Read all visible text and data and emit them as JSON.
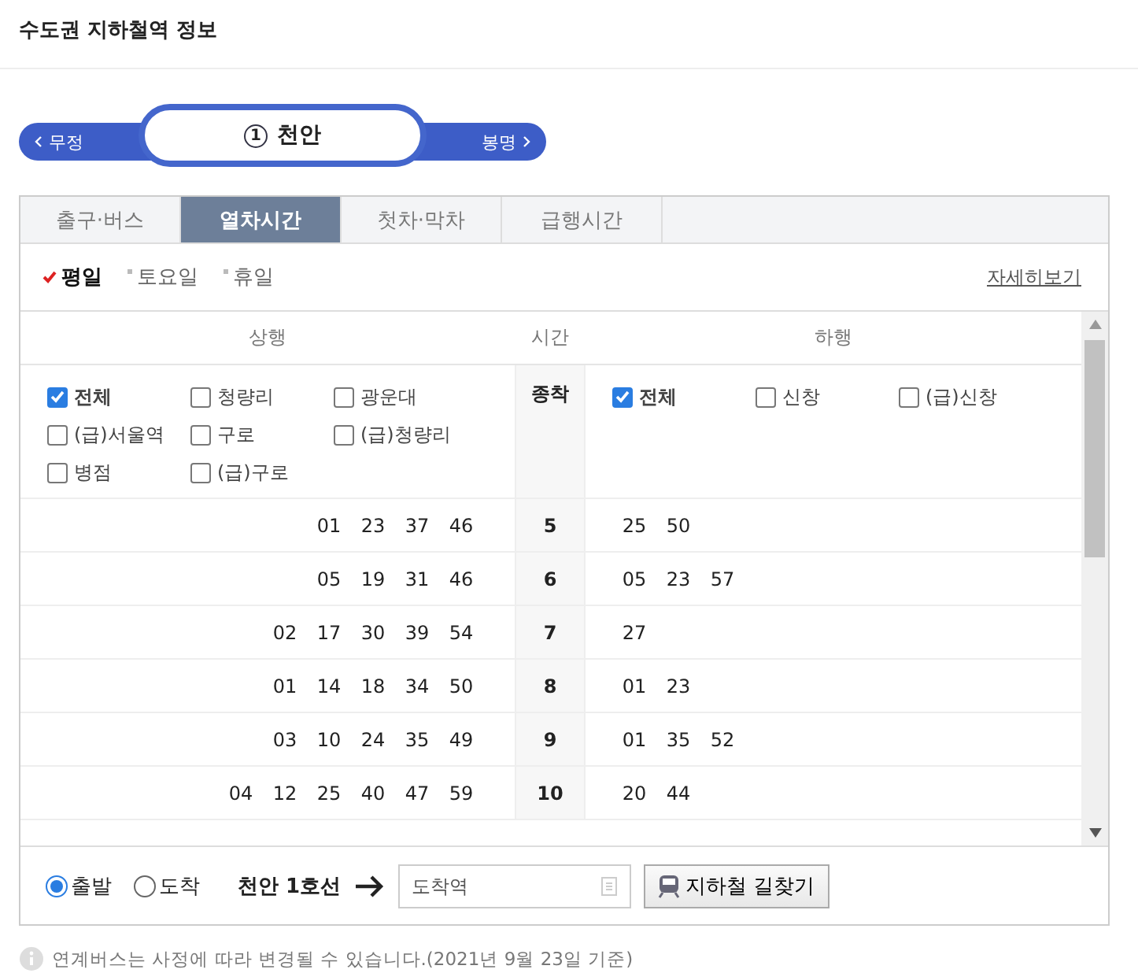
{
  "page_title": "수도권 지하철역 정보",
  "station_nav": {
    "prev": "무정",
    "line_badge": "1",
    "current": "천안",
    "next": "봉명"
  },
  "tabs": [
    {
      "label": "출구·버스",
      "selected": false
    },
    {
      "label": "열차시간",
      "selected": true
    },
    {
      "label": "첫차·막차",
      "selected": false
    },
    {
      "label": "급행시간",
      "selected": false
    }
  ],
  "day_types": [
    {
      "label": "평일",
      "selected": true
    },
    {
      "label": "토요일",
      "selected": false
    },
    {
      "label": "휴일",
      "selected": false
    }
  ],
  "detail_link": "자세히보기",
  "timetable": {
    "headers": {
      "up": "상행",
      "time": "시간",
      "down": "하행"
    },
    "up_filters": [
      {
        "label": "전체",
        "checked": true
      },
      {
        "label": "청량리",
        "checked": false
      },
      {
        "label": "광운대",
        "checked": false
      },
      {
        "label": "(급)서울역",
        "checked": false
      },
      {
        "label": "구로",
        "checked": false
      },
      {
        "label": "(급)청량리",
        "checked": false
      },
      {
        "label": "병점",
        "checked": false
      },
      {
        "label": "(급)구로",
        "checked": false
      }
    ],
    "terminal_label": "종착",
    "down_filters": [
      {
        "label": "전체",
        "checked": true
      },
      {
        "label": "신창",
        "checked": false
      },
      {
        "label": "(급)신창",
        "checked": false
      }
    ],
    "rows": [
      {
        "hour": "5",
        "up": [
          "01",
          "23",
          "37",
          "46"
        ],
        "down": [
          "25",
          "50"
        ]
      },
      {
        "hour": "6",
        "up": [
          "05",
          "19",
          "31",
          "46"
        ],
        "down": [
          "05",
          "23",
          "57"
        ]
      },
      {
        "hour": "7",
        "up": [
          "02",
          "17",
          "30",
          "39",
          "54"
        ],
        "down": [
          "27"
        ]
      },
      {
        "hour": "8",
        "up": [
          "01",
          "14",
          "18",
          "34",
          "50"
        ],
        "down": [
          "01",
          "23"
        ]
      },
      {
        "hour": "9",
        "up": [
          "03",
          "10",
          "24",
          "35",
          "49"
        ],
        "down": [
          "01",
          "35",
          "52"
        ]
      },
      {
        "hour": "10",
        "up": [
          "04",
          "12",
          "25",
          "40",
          "47",
          "59"
        ],
        "down": [
          "20",
          "44"
        ]
      }
    ]
  },
  "route_bar": {
    "options": [
      {
        "label": "출발",
        "selected": true
      },
      {
        "label": "도착",
        "selected": false
      }
    ],
    "station_line": "천안 1호선",
    "placeholder": "도착역",
    "button": "지하철 길찾기"
  },
  "notice": "연계버스는 사정에 따라 변경될 수 있습니다.(2021년 9월 23일 기준)"
}
